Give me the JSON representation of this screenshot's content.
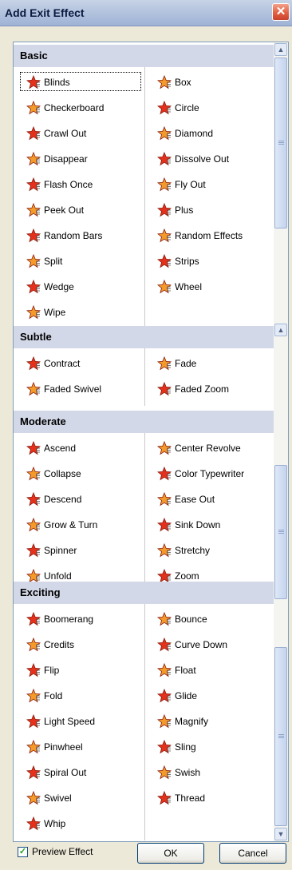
{
  "window": {
    "title": "Add Exit Effect",
    "close_symbol": "✕"
  },
  "sections": [
    {
      "name": "Basic",
      "left": [
        "Blinds",
        "Checkerboard",
        "Crawl Out",
        "Disappear",
        "Flash Once",
        "Peek Out",
        "Random Bars",
        "Split",
        "Wedge",
        "Wipe"
      ],
      "right": [
        "Box",
        "Circle",
        "Diamond",
        "Dissolve Out",
        "Fly Out",
        "Plus",
        "Random Effects",
        "Strips",
        "Wheel"
      ],
      "selected": "Blinds"
    },
    {
      "name": "Subtle",
      "left": [
        "Contract",
        "Faded Swivel"
      ],
      "right": [
        "Fade",
        "Faded Zoom"
      ]
    },
    {
      "name": "Moderate",
      "left": [
        "Ascend",
        "Collapse",
        "Descend",
        "Grow & Turn",
        "Spinner",
        "Unfold"
      ],
      "right": [
        "Center Revolve",
        "Color Typewriter",
        "Ease Out",
        "Sink Down",
        "Stretchy",
        "Zoom"
      ]
    },
    {
      "name": "Exciting",
      "left": [
        "Boomerang",
        "Credits",
        "Flip",
        "Fold",
        "Light Speed",
        "Pinwheel",
        "Spiral Out",
        "Swivel",
        "Whip"
      ],
      "right": [
        "Bounce",
        "Curve Down",
        "Float",
        "Glide",
        "Magnify",
        "Sling",
        "Swish",
        "Thread"
      ]
    }
  ],
  "footer": {
    "preview_label": "Preview Effect",
    "preview_checked": true,
    "ok_label": "OK",
    "cancel_label": "Cancel"
  },
  "colors": {
    "star_red": "#e5311c",
    "star_orange": "#f49a2a",
    "header_bg": "#d3d8e8"
  }
}
